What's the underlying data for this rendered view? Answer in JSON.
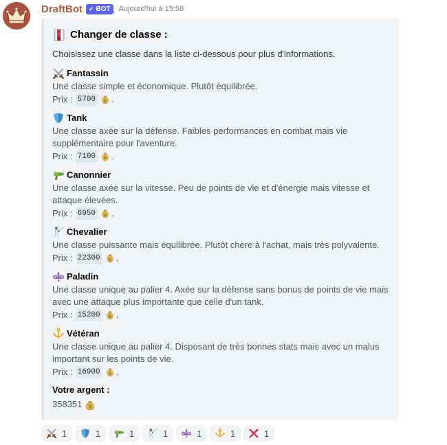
{
  "message": {
    "username": "DraftBot",
    "bot_tag": "BOT",
    "timestamp": "Aujourd'hui à 15:58",
    "avatar_icon": "crown-icon"
  },
  "embed": {
    "title_icon": "book-icon",
    "title": "Changer de classe :",
    "description": "Choisissez une classe dans la liste ci-dessous pour plus d'informations.",
    "price_label": "Prix :",
    "price_suffix": ".",
    "classes": [
      {
        "icon": "crossed-swords-icon",
        "name": "Fantassin",
        "desc": "Une classe simple et économique. Plutôt équilibrée.",
        "price": "5700"
      },
      {
        "icon": "shield-icon",
        "name": "Tank",
        "desc": "Une classe axée sur la défense. Faibles performances en combat mais vie supplémentaire pour l'aventure.",
        "price": "7100"
      },
      {
        "icon": "water-pistol-icon",
        "name": "Canonnier",
        "desc": "Une classe axée sur la vitesse. Peu de points de vie et d'énergie mais vitesse et attaque élevées.",
        "price": "6950"
      },
      {
        "icon": "fencer-icon",
        "name": "Chevalier",
        "desc": "Une classe puissante mais équilibrée. Plutôt chère à l'achat, mais très polyvalente.",
        "price": "22300"
      },
      {
        "icon": "fleur-de-lis-icon",
        "name": "Paladin",
        "desc": "Une classe unique au palier 4. Axée sur la défense sans bonus de points de vie mais avec une attaque plus importante que celle d'un tank.",
        "price": "15200"
      },
      {
        "icon": "trident-icon",
        "name": "Vétéran",
        "desc": "Une classe unique au palier 4. Disposant de très bonnes stats mais avec un malus important sur les points de vie.",
        "price": "16900"
      }
    ],
    "money_label": "Votre argent :",
    "money_value": "358351",
    "money_icon": "money-bag-icon"
  },
  "reactions": [
    {
      "icon": "crossed-swords-icon",
      "count": "1"
    },
    {
      "icon": "shield-icon",
      "count": "1"
    },
    {
      "icon": "water-pistol-icon",
      "count": "1"
    },
    {
      "icon": "fencer-icon",
      "count": "1"
    },
    {
      "icon": "fleur-de-lis-icon",
      "count": "1"
    },
    {
      "icon": "trident-icon",
      "count": "1"
    },
    {
      "icon": "cross-mark-icon",
      "count": "1"
    }
  ],
  "colors": {
    "username": "#b05a3d",
    "bot_tag": "#5865f2",
    "embed_bg": "#f2f3f5",
    "embed_border": "#e3e5e8"
  }
}
